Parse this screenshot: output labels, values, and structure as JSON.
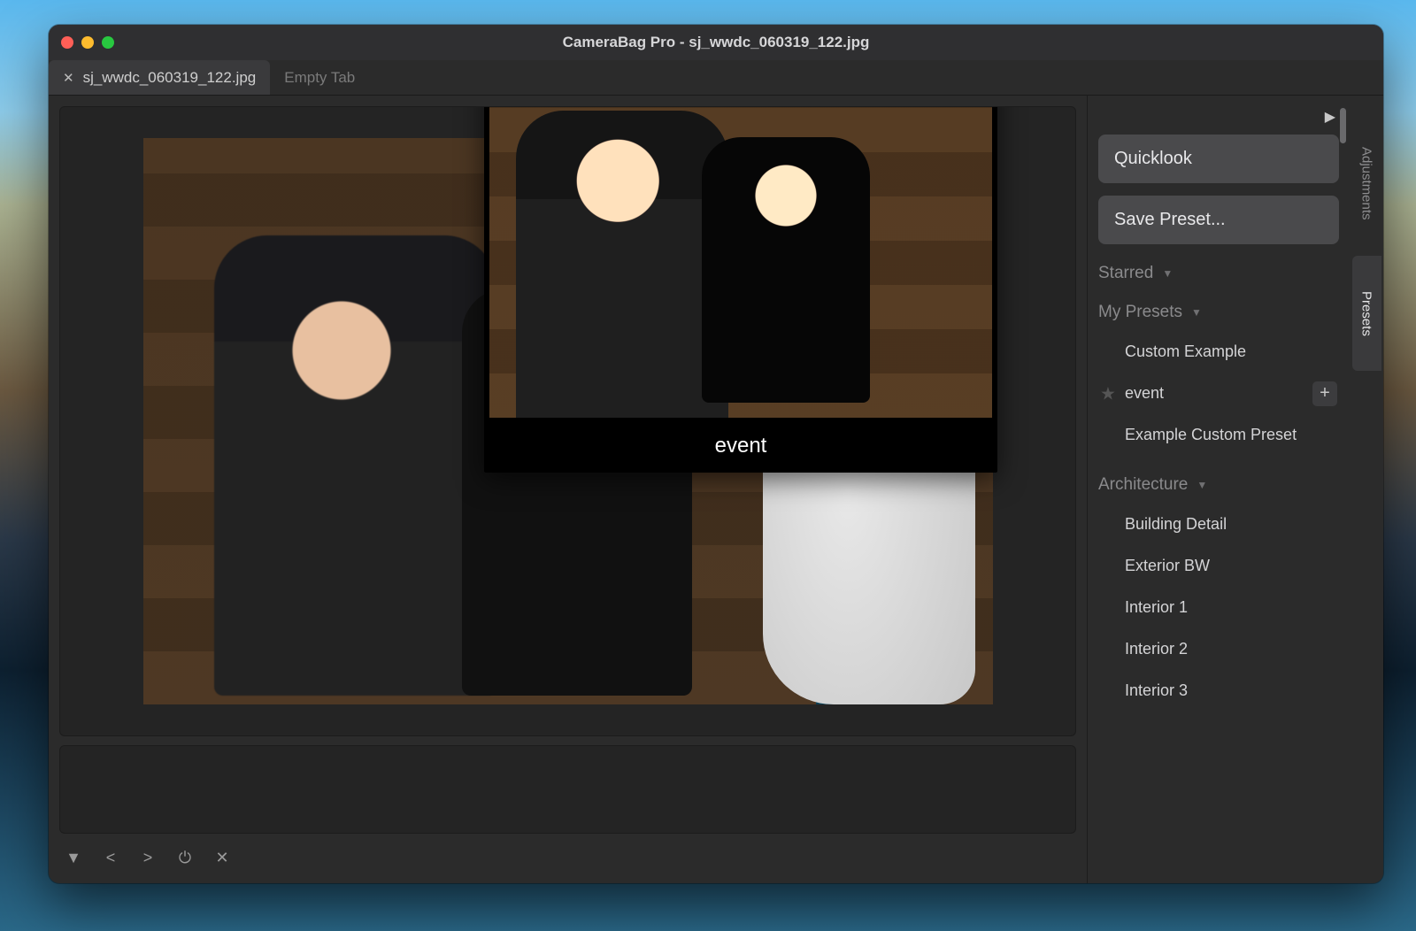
{
  "window_title": "CameraBag Pro - sj_wwdc_060319_122.jpg",
  "tabs": [
    {
      "label": "sj_wwdc_060319_122.jpg",
      "active": true
    },
    {
      "label": "Empty Tab",
      "active": false
    }
  ],
  "overlay_preview_label": "event",
  "right_panel": {
    "quicklook_label": "Quicklook",
    "save_preset_label": "Save Preset...",
    "sections": {
      "starred": {
        "label": "Starred"
      },
      "my_presets": {
        "label": "My Presets",
        "items": [
          "Custom Example",
          "event",
          "Example Custom Preset"
        ],
        "selected_index": 1
      },
      "architecture": {
        "label": "Architecture",
        "items": [
          "Building Detail",
          "Exterior BW",
          "Interior 1",
          "Interior 2",
          "Interior 3"
        ]
      }
    },
    "vertical_tabs": {
      "adjustments": "Adjustments",
      "presets": "Presets"
    }
  },
  "footer_icons": [
    "▼",
    "<",
    ">",
    "⏻",
    "✕"
  ]
}
